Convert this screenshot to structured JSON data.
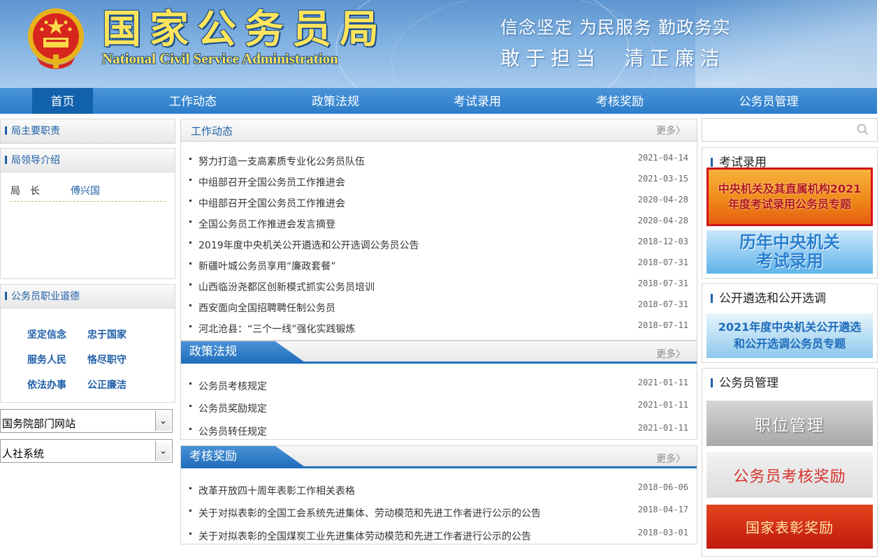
{
  "header": {
    "title": "国家公务员局",
    "subtitle": "National Civil Service Administration",
    "slogan_line1": "信念坚定 为民服务 勤政务实",
    "slogan_line2": "敢于担当  清正廉洁"
  },
  "nav": {
    "items": [
      "首页",
      "工作动态",
      "政策法规",
      "考试录用",
      "考核奖励",
      "公务员管理"
    ],
    "active": "首页"
  },
  "left": {
    "duties_title": "局主要职责",
    "leaders_title": "局领导介绍",
    "leader_role": "局长",
    "leader_name": "傅兴国",
    "ethics_title": "公务员职业道德",
    "ethics": [
      "坚定信念",
      "忠于国家",
      "服务人民",
      "恪尽职守",
      "依法办事",
      "公正廉洁"
    ],
    "select1": "国务院部门网站",
    "select2": "人社系统"
  },
  "work_news": {
    "title": "工作动态",
    "more": "更多〉",
    "items": [
      {
        "title": "努力打造一支高素质专业化公务员队伍",
        "date": "2021-04-14"
      },
      {
        "title": "中组部召开全国公务员工作推进会",
        "date": "2021-03-15"
      },
      {
        "title": "中组部召开全国公务员工作推进会",
        "date": "2020-04-28"
      },
      {
        "title": "全国公务员工作推进会发言摘登",
        "date": "2020-04-28"
      },
      {
        "title": "2019年度中央机关公开遴选和公开选调公务员公告",
        "date": "2018-12-03"
      },
      {
        "title": "新疆叶城公务员享用“廉政套餐”",
        "date": "2018-07-31"
      },
      {
        "title": "山西临汾尧都区创新模式抓实公务员培训",
        "date": "2018-07-31"
      },
      {
        "title": "西安面向全国招聘聘任制公务员",
        "date": "2018-07-31"
      },
      {
        "title": "河北沧县：“三个一线”强化实践锻炼",
        "date": "2018-07-11"
      }
    ]
  },
  "policy": {
    "title": "政策法规",
    "more": "更多〉",
    "items": [
      {
        "title": "公务员考核规定",
        "date": "2021-01-11"
      },
      {
        "title": "公务员奖励规定",
        "date": "2021-01-11"
      },
      {
        "title": "公务员转任规定",
        "date": "2021-01-11"
      }
    ]
  },
  "awards": {
    "title": "考核奖励",
    "more": "更多〉",
    "items": [
      {
        "title": "改革开放四十周年表彰工作相关表格",
        "date": "2018-06-06"
      },
      {
        "title": "关于对拟表彰的全国工会系统先进集体、劳动模范和先进工作者进行公示的公告",
        "date": "2018-04-17"
      },
      {
        "title": "关于对拟表彰的全国煤炭工业先进集体劳动模范和先进工作者进行公示的公告",
        "date": "2018-03-01"
      }
    ]
  },
  "right": {
    "exam_title": "考试录用",
    "exam_banner_line1": "中央机关及其直属机构2021",
    "exam_banner_line2": "年度考试录用公务员专题",
    "exam_history_line1": "历年中央机关",
    "exam_history_line2": "考试录用",
    "selection_title": "公开遴选和公开选调",
    "selection_banner_line1": "2021年度中央机关公开遴选",
    "selection_banner_line2": "和公开选调公务员专题",
    "mgmt_title": "公务员管理",
    "mgmt_banner1": "职位管理",
    "mgmt_banner2": "公务员考核奖励",
    "mgmt_banner3": "国家表彰奖励"
  },
  "colors": {
    "nav_blue": "#2b7cc9",
    "nav_active": "#1261ad",
    "link_blue": "#1f5fa8",
    "title_yellow": "#ffe45c",
    "highlight_red": "#d3141a"
  }
}
